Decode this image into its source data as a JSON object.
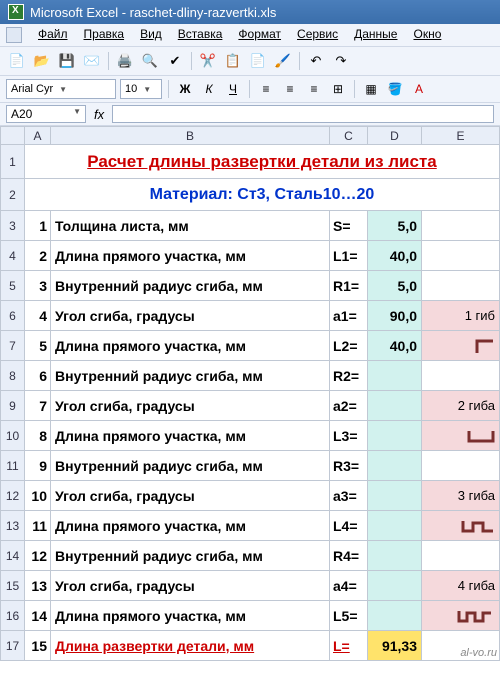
{
  "window": {
    "title": "Microsoft Excel - raschet-dliny-razvertki.xls"
  },
  "menu": {
    "items": [
      "Файл",
      "Правка",
      "Вид",
      "Вставка",
      "Формат",
      "Сервис",
      "Данные",
      "Окно"
    ]
  },
  "format_bar": {
    "font": "Arial Cyr",
    "size": "10"
  },
  "namebox": {
    "cell": "A20",
    "fx_label": "fx"
  },
  "columns": [
    "A",
    "B",
    "C",
    "D",
    "E"
  ],
  "header": {
    "title": "Расчет длины развертки детали из листа",
    "material": "Материал: Ст3, Сталь10…20"
  },
  "rows": [
    {
      "n": "1",
      "label": "Толщина листа, мм",
      "sym": "S=",
      "val": "5,0",
      "e": "",
      "e_bg": "",
      "d_bg": "bg-turq"
    },
    {
      "n": "2",
      "label": "Длина прямого участка, мм",
      "sym": "L1=",
      "val": "40,0",
      "e": "",
      "e_bg": "",
      "d_bg": "bg-turq"
    },
    {
      "n": "3",
      "label": "Внутренний радиус сгиба, мм",
      "sym": "R1=",
      "val": "5,0",
      "e": "",
      "e_bg": "",
      "d_bg": "bg-turq"
    },
    {
      "n": "4",
      "label": "Угол сгиба, градусы",
      "sym": "a1=",
      "val": "90,0",
      "e": "1 гиб",
      "e_bg": "bg-pink",
      "d_bg": "bg-turq",
      "bend": 1
    },
    {
      "n": "5",
      "label": "Длина прямого участка, мм",
      "sym": "L2=",
      "val": "40,0",
      "e": "",
      "e_bg": "bg-pink",
      "d_bg": "bg-turq",
      "bendshape": 1
    },
    {
      "n": "6",
      "label": "Внутренний радиус сгиба, мм",
      "sym": "R2=",
      "val": "",
      "e": "",
      "e_bg": "",
      "d_bg": "bg-turq"
    },
    {
      "n": "7",
      "label": "Угол сгиба, градусы",
      "sym": "a2=",
      "val": "",
      "e": "2 гиба",
      "e_bg": "bg-pink",
      "d_bg": "bg-turq",
      "bend": 2
    },
    {
      "n": "8",
      "label": "Длина прямого участка, мм",
      "sym": "L3=",
      "val": "",
      "e": "",
      "e_bg": "bg-pink",
      "d_bg": "bg-turq",
      "bendshape": 2
    },
    {
      "n": "9",
      "label": "Внутренний радиус сгиба, мм",
      "sym": "R3=",
      "val": "",
      "e": "",
      "e_bg": "",
      "d_bg": "bg-turq"
    },
    {
      "n": "10",
      "label": "Угол сгиба, градусы",
      "sym": "a3=",
      "val": "",
      "e": "3 гиба",
      "e_bg": "bg-pink",
      "d_bg": "bg-turq",
      "bend": 3
    },
    {
      "n": "11",
      "label": "Длина прямого участка, мм",
      "sym": "L4=",
      "val": "",
      "e": "",
      "e_bg": "bg-pink",
      "d_bg": "bg-turq",
      "bendshape": 3
    },
    {
      "n": "12",
      "label": "Внутренний радиус сгиба, мм",
      "sym": "R4=",
      "val": "",
      "e": "",
      "e_bg": "",
      "d_bg": "bg-turq"
    },
    {
      "n": "13",
      "label": "Угол сгиба, градусы",
      "sym": "a4=",
      "val": "",
      "e": "4 гиба",
      "e_bg": "bg-pink",
      "d_bg": "bg-turq",
      "bend": 4
    },
    {
      "n": "14",
      "label": "Длина прямого участка, мм",
      "sym": "L5=",
      "val": "",
      "e": "",
      "e_bg": "bg-pink",
      "d_bg": "bg-turq",
      "bendshape": 4
    },
    {
      "n": "15",
      "label": "Длина развертки детали, мм",
      "sym": "L=",
      "val": "91,33",
      "e": "al-vo.ru",
      "e_bg": "",
      "d_bg": "bg-yellow",
      "red": true
    }
  ]
}
